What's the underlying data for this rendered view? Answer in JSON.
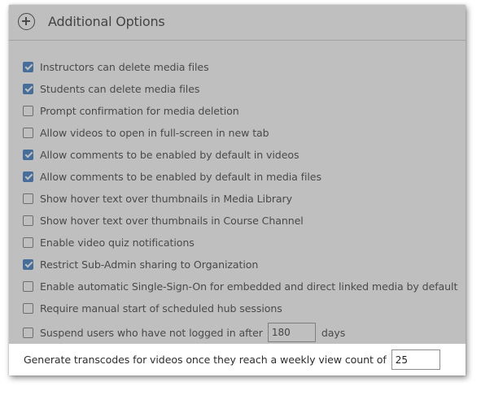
{
  "header": {
    "title": "Additional Options",
    "icon": "plus-circle-icon"
  },
  "options": [
    {
      "label": "Instructors can delete media files",
      "checked": true
    },
    {
      "label": "Students can delete media files",
      "checked": true
    },
    {
      "label": "Prompt confirmation for media deletion",
      "checked": false
    },
    {
      "label": "Allow videos to open in full-screen in new tab",
      "checked": false
    },
    {
      "label": "Allow comments to be enabled by default in videos",
      "checked": true
    },
    {
      "label": "Allow comments to be enabled by default in media files",
      "checked": true
    },
    {
      "label": "Show hover text over thumbnails in Media Library",
      "checked": false
    },
    {
      "label": "Show hover text over thumbnails in Course Channel",
      "checked": false
    },
    {
      "label": "Enable video quiz notifications",
      "checked": false
    },
    {
      "label": "Restrict Sub-Admin sharing to Organization",
      "checked": true
    },
    {
      "label": "Enable automatic Single-Sign-On for embedded and direct linked media by default",
      "checked": false
    },
    {
      "label": "Require manual start of scheduled hub sessions",
      "checked": false
    }
  ],
  "suspend": {
    "label_before": "Suspend users who have not logged in after",
    "value": "180",
    "label_after": "days",
    "checked": false
  },
  "transcode": {
    "label": "Generate transcodes for videos once they reach a weekly view count of",
    "value": "25"
  },
  "colors": {
    "checkbox_checked": "#2a6ebd",
    "overlay": "#6e6e6e"
  }
}
